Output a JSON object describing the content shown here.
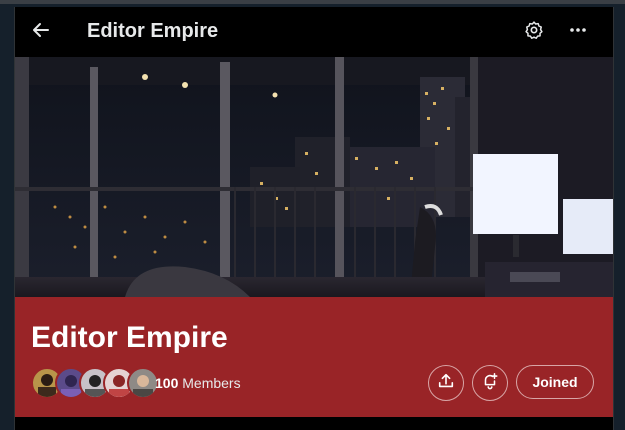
{
  "header": {
    "title": "Editor Empire",
    "back_icon": "arrow-left-icon",
    "settings_icon": "gear-icon",
    "more_icon": "more-horizontal-icon"
  },
  "community": {
    "name": "Editor Empire",
    "member_count": "100",
    "member_label": "Members",
    "joined_label": "Joined",
    "accent_color": "#992427",
    "share_icon": "share-icon",
    "notify_icon": "bell-plus-icon"
  },
  "banner": {
    "description_icon": "city-night-desk-photo"
  }
}
